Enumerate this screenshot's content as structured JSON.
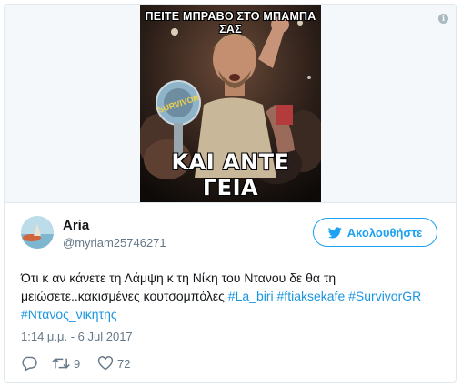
{
  "media": {
    "meme_top_text": "ΠΕΙΤΕ ΜΠΡΑΒΟ ΣΤΟ ΜΠΑΜΠΑ ΣΑΣ",
    "meme_bottom_text": "ΚΑΙ ΑΝΤΕ ΓΕΙΑ",
    "trophy_logo_text": "SURVIVOR"
  },
  "user": {
    "name": "Aria",
    "handle": "@myriam25746271"
  },
  "follow_label": "Ακολουθήστε",
  "tweet": {
    "text": "Ότι κ αν κάνετε τη Λάμψη κ τη Νίκη του Ντανου δε θα τη μειώσετε..κακισμένες κουτσομπόλες",
    "hashtags": [
      "#La_biri",
      "#ftiaksekafe",
      "#SurvivorGR",
      "#Ντανος_νικητης"
    ]
  },
  "timestamp": "1:14 μ.μ. - 6 Jul 2017",
  "stats": {
    "retweets": "9",
    "likes": "72"
  },
  "colors": {
    "link": "#1b95e0",
    "button": "#1da1f2",
    "secondary_text": "#657786",
    "primary_text": "#14171a",
    "border": "#e1e8ed"
  },
  "icons": [
    "info-icon",
    "twitter-bird-icon",
    "reply-icon",
    "retweet-icon",
    "heart-icon"
  ]
}
